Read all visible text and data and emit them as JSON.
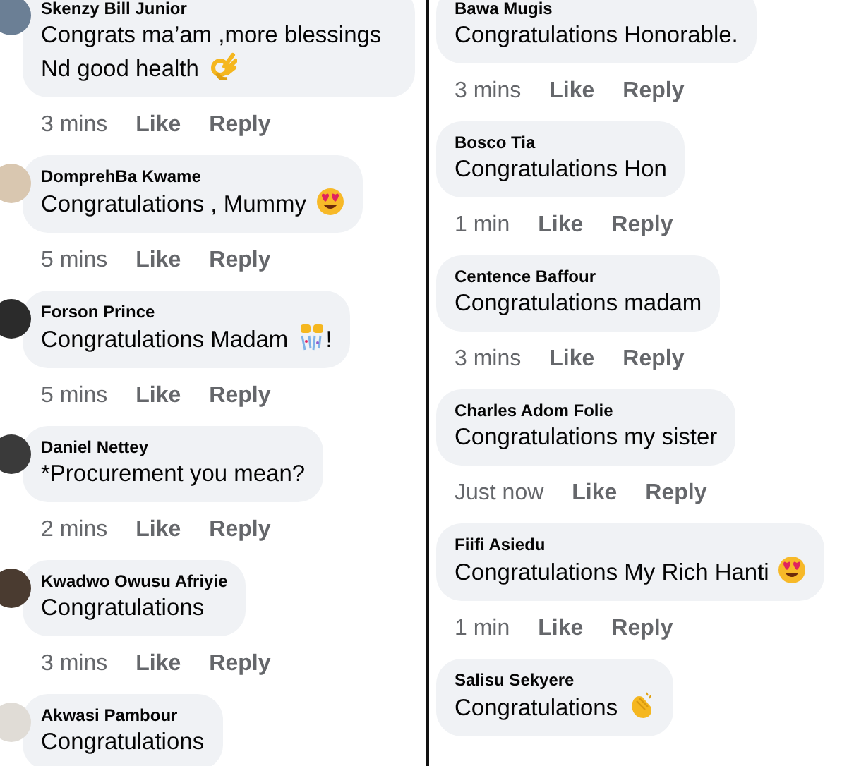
{
  "left_column": [
    {
      "author": "Skenzy Bill Junior",
      "text": "Congrats ma’am ,more blessings Nd good health",
      "kind": "okhand",
      "time": "3 mins",
      "like": "Like",
      "reply": "Reply"
    },
    {
      "author": "DomprehBa Kwame",
      "text": "Congratulations , Mummy",
      "kind": "hearteyes",
      "time": "5 mins",
      "like": "Like",
      "reply": "Reply"
    },
    {
      "author": "Forson Prince",
      "text": "Congratulations Madam",
      "kind": "party",
      "text_after": "!",
      "time": "5 mins",
      "like": "Like",
      "reply": "Reply"
    },
    {
      "author": "Daniel Nettey",
      "text": "*Procurement you mean?",
      "time": "2 mins",
      "like": "Like",
      "reply": "Reply"
    },
    {
      "author": "Kwadwo Owusu Afriyie",
      "text": "Congratulations",
      "time": "3 mins",
      "like": "Like",
      "reply": "Reply"
    },
    {
      "author": "Akwasi Pambour",
      "text": "Congratulations"
    }
  ],
  "right_column": [
    {
      "author": "Bawa Mugis",
      "text": "Congratulations Honorable.",
      "time": "3 mins",
      "like": "Like",
      "reply": "Reply"
    },
    {
      "author": "Bosco Tia",
      "text": "Congratulations Hon",
      "time": "1 min",
      "like": "Like",
      "reply": "Reply"
    },
    {
      "author": "Centence Baffour",
      "text": "Congratulations madam",
      "time": "3 mins",
      "like": "Like",
      "reply": "Reply"
    },
    {
      "author": "Charles Adom Folie",
      "text": "Congratulations my sister",
      "time": "Just now",
      "like": "Like",
      "reply": "Reply"
    },
    {
      "author": "Fiifi Asiedu",
      "text": "Congratulations My Rich Hanti",
      "kind": "hearteyes",
      "time": "1 min",
      "like": "Like",
      "reply": "Reply"
    },
    {
      "author": "Salisu Sekyere",
      "text": "Congratulations",
      "kind": "clap"
    }
  ]
}
